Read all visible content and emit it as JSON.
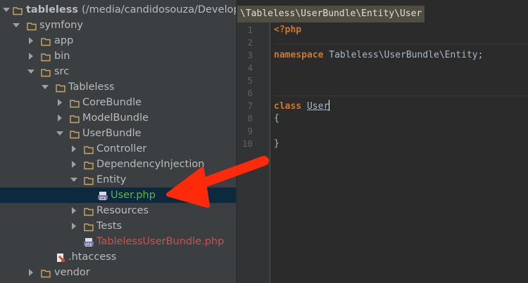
{
  "project_tree": {
    "root": {
      "name": "tableless",
      "path": "(/media/candidosouza/Developm"
    },
    "items": [
      {
        "label": "symfony"
      },
      {
        "label": "app"
      },
      {
        "label": "bin"
      },
      {
        "label": "src"
      },
      {
        "label": "Tableless"
      },
      {
        "label": "CoreBundle"
      },
      {
        "label": "ModelBundle"
      },
      {
        "label": "UserBundle"
      },
      {
        "label": "Controller"
      },
      {
        "label": "DependencyInjection"
      },
      {
        "label": "Entity"
      },
      {
        "label": "User.php"
      },
      {
        "label": "Resources"
      },
      {
        "label": "Tests"
      },
      {
        "label": "TablelessUserBundle.php"
      },
      {
        "label": ".htaccess"
      },
      {
        "label": "vendor"
      }
    ]
  },
  "editor": {
    "breadcrumb": "\\Tableless\\UserBundle\\Entity\\User",
    "line_numbers": [
      "1",
      "2",
      "3",
      "4",
      "5",
      "6",
      "7",
      "8",
      "9",
      "10"
    ],
    "code": {
      "l1_open_tag": "<?php",
      "l3_keyword": "namespace",
      "l3_rest": " Tableless\\UserBundle\\Entity;",
      "l7_keyword": "class",
      "l7_name": "User",
      "l8": "{",
      "l10": "}"
    }
  },
  "colors": {
    "tree_bg": "#3c3f41",
    "selected_row": "#0d293e",
    "keyword": "#cc7832",
    "arrow": "#ff2a0a",
    "modified_file": "#62b543",
    "untracked_file": "#c75450"
  }
}
